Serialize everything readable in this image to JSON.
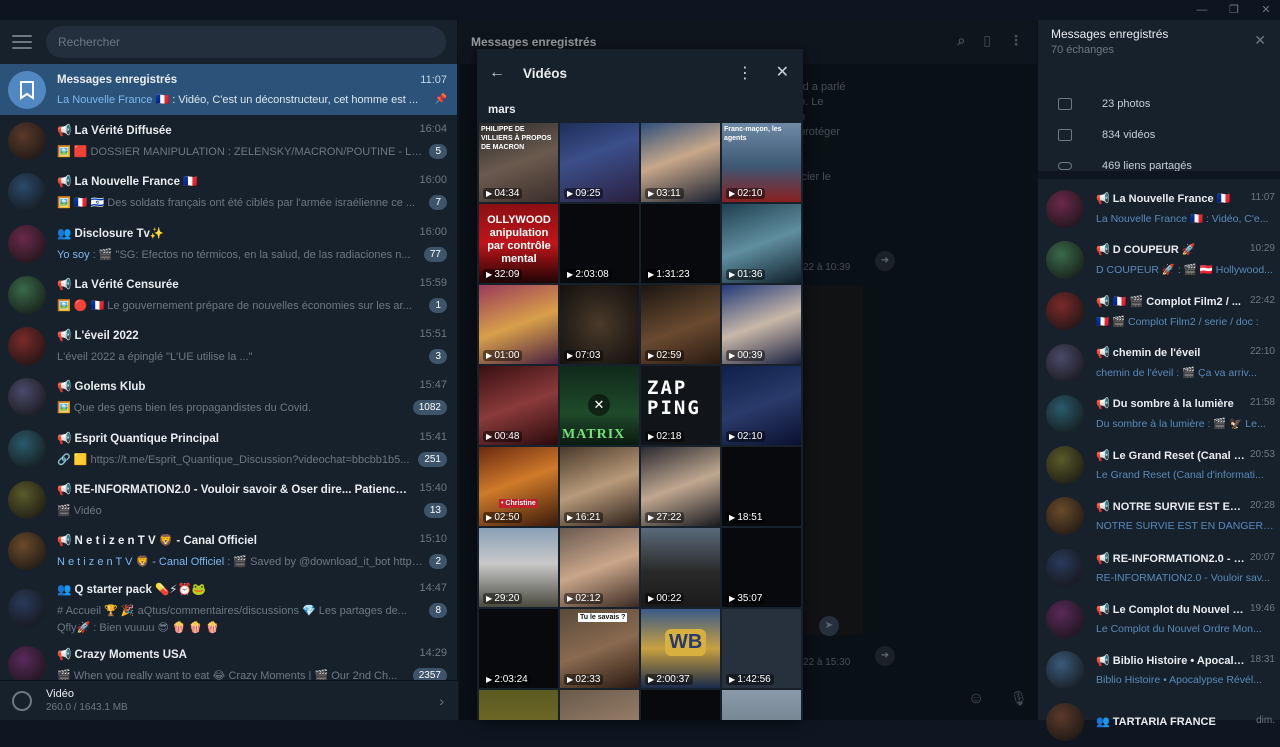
{
  "window": {
    "minimize_glyph": "—",
    "maximize_glyph": "❐",
    "close_glyph": "✕"
  },
  "left": {
    "search_placeholder": "Rechercher",
    "chats": [
      {
        "name": "Messages enregistrés",
        "time": "11:07",
        "sender": "La Nouvelle France 🇫🇷",
        "msg": " : Vidéo, C'est un déconstructeur, cet homme est ...",
        "pinned": "📌",
        "active": true,
        "avatar": "bookmark-icon"
      },
      {
        "name": "📢 La Vérité Diffusée",
        "time": "16:04",
        "msg": "🖼️ 🟥 DOSSIER MANIPULATION : ZELENSKY/MACRON/POUTINE - LES PE...",
        "badge": "5"
      },
      {
        "name": "📢 La Nouvelle France 🇫🇷",
        "time": "16:00",
        "msg": "🖼️ 🇫🇷 🇮🇱 Des soldats français ont été ciblés par l'armée israélienne ce ...",
        "badge": "7"
      },
      {
        "name": "👥 Disclosure Tv✨",
        "time": "16:00",
        "sender": "Yo soy",
        "msg": " : 🎬 \"SG: Efectos no térmicos, en la salud, de las radiaciones n...",
        "badge": "77"
      },
      {
        "name": "📢 La Vérité Censurée",
        "time": "15:59",
        "msg": "🖼️ 🔴 🇫🇷 Le gouvernement prépare de nouvelles économies sur les ar...",
        "badge": "1"
      },
      {
        "name": "📢 L'éveil 2022",
        "time": "15:51",
        "msg": "L'éveil 2022 a épinglé \"L'UE utilise la ...\"",
        "badge": "3"
      },
      {
        "name": "📢 Golems Klub",
        "time": "15:47",
        "msg": "🖼️ Que des gens bien les propagandistes du Covid.",
        "badge": "1082"
      },
      {
        "name": "📢 Esprit Quantique Principal",
        "time": "15:41",
        "msg": "🔗 🟨 https://t.me/Esprit_Quantique_Discussion?videochat=bbcbb1b5...",
        "badge": "251"
      },
      {
        "name": "📢 RE-INFORMATION2.0 - Vouloir savoir & Oser dire... Patience & Pers...",
        "time": "15:40",
        "msg": "🎬 Vidéo",
        "badge": "13"
      },
      {
        "name": "📢 N e t i z e n T V 🦁 - Canal Officiel",
        "time": "15:10",
        "sender": "N e t i z e n T V 🦁 - Canal Officiel",
        "msg": " : 🎬 Saved by @download_it_bot https...",
        "badge": "2"
      },
      {
        "name": "👥 Q starter pack 💊⚡⏰🐸",
        "time": "14:47",
        "msg": "# Accueil 🏆 🎉 aQtus/commentaires/discussions 💎 Les partages de...",
        "msg2": "Qfly🚀 : Bien vuuuu 😎 🍿 🍿 🍿",
        "badge": "8"
      },
      {
        "name": "📢 Crazy Moments USA",
        "time": "14:29",
        "msg": "🎬 When you really want to eat 😂 Crazy Moments | 🎬 Our 2nd Ch...",
        "badge": "2357"
      }
    ],
    "bottom": {
      "title": "Vidéo",
      "size": "260.0 / 1643.1 MB"
    }
  },
  "center": {
    "title": "Messages enregistrés",
    "bg_lines": [
      "rd a parlé",
      "b. Le",
      "n",
      "protéger",
      "",
      "",
      "icier le"
    ],
    "time1": "22 à 10:39",
    "time2": "22 à 15:30"
  },
  "panel": {
    "title": "Vidéos",
    "month": "mars",
    "tiles": [
      {
        "duration": "04:34",
        "bg": "linear-gradient(160deg,#2a2a2a 0%,#6b5a4e 50%,#3b2e2a 100%)",
        "text": "PHILIPPE DE VILLIERS À PROPOS DE MACRON"
      },
      {
        "duration": "09:25",
        "bg": "linear-gradient(160deg,#1d2f59 0%,#3b4f8a 40%,#2a2040 100%)"
      },
      {
        "duration": "03:11",
        "bg": "linear-gradient(160deg,#2f4f7a 0%,#c8a88a 45%,#1a2030 100%)"
      },
      {
        "duration": "02:10",
        "bg": "linear-gradient(180deg,#6f8aa6 0%,#3d5873 55%,#8a2020 100%)",
        "text": "Franc-maçon, les agents"
      },
      {
        "duration": "32:09",
        "bg": "linear-gradient(180deg,#8a0f12 0%,#c0151a 50%,#200405 100%)",
        "text": "OLLYWOOD anipulation par contrôle mental"
      },
      {
        "duration": "2:03:08",
        "bg": "#07090c"
      },
      {
        "duration": "1:31:23",
        "bg": "#07090c"
      },
      {
        "duration": "01:36",
        "bg": "linear-gradient(160deg,#1f3f4f 0%,#5f8fa0 50%,#0f1f2a 100%)"
      },
      {
        "duration": "01:00",
        "bg": "linear-gradient(160deg,#9a3a5a 0%,#d8a04a 50%,#4a2040 100%)"
      },
      {
        "duration": "07:03",
        "bg": "radial-gradient(circle,#4a3a2a 0%,#2a221a 55%,#141010 100%)"
      },
      {
        "duration": "02:59",
        "bg": "linear-gradient(160deg,#1a1612 0%,#6a4a30 55%,#2a1a10 100%)"
      },
      {
        "duration": "00:39",
        "bg": "linear-gradient(160deg,#223a7a 0%,#c8b8a8 50%,#1a2040 100%)"
      },
      {
        "duration": "00:48",
        "bg": "linear-gradient(160deg,#3a0f12 0%,#8a3a3a 50%,#2a0a0c 100%)"
      },
      {
        "duration": "",
        "bg": "linear-gradient(180deg,#0f2a1a 0%,#1f4a2a 60%,#0a1a10 100%)",
        "text": "MATRIX",
        "closeglyph": "✕"
      },
      {
        "duration": "02:18",
        "bg": "#111418",
        "text": "ZAP PING"
      },
      {
        "duration": "02:10",
        "bg": "linear-gradient(160deg,#10204a 0%,#2a3a6a 50%,#0a1030 100%)"
      },
      {
        "duration": "02:50",
        "bg": "linear-gradient(160deg,#6a2a10 0%,#d07a2a 45%,#3a1a0a 100%)",
        "text": "• Christine"
      },
      {
        "duration": "16:21",
        "bg": "linear-gradient(160deg,#4a3a2a 0%,#b89a7a 50%,#2a2018 100%)"
      },
      {
        "duration": "27:22",
        "bg": "linear-gradient(160deg,#2a2a30 0%,#c0a890 50%,#1a1a20 100%)"
      },
      {
        "duration": "18:51",
        "bg": "#07090c"
      },
      {
        "duration": "29:20",
        "bg": "linear-gradient(180deg,#8aa0b8 0%,#c8c8c8 45%,#4a4a40 100%)"
      },
      {
        "duration": "02:12",
        "bg": "linear-gradient(160deg,#6a5a50 0%,#caa68a 50%,#3a2a22 100%)"
      },
      {
        "duration": "00:22",
        "bg": "linear-gradient(180deg,#5a6a7a 0%,#2a2a2a 55%,#1a1a1a 100%)"
      },
      {
        "duration": "35:07",
        "bg": "#07090c"
      },
      {
        "duration": "2:03:24",
        "bg": "#07090c"
      },
      {
        "duration": "02:33",
        "bg": "linear-gradient(160deg,#5a4a3a 0%,#8a6a50 50%,#2a1a12 100%)",
        "text": "Tu le savais ?"
      },
      {
        "duration": "2:00:37",
        "bg": "linear-gradient(180deg,#3a5a8a 0%,#c8a040 50%,#1a2a4a 100%)",
        "text": "WB"
      },
      {
        "duration": "1:42:56",
        "bg": "#26313d"
      },
      {
        "duration": "",
        "bg": "linear-gradient(180deg,#5a5a20 0%,#8a7a30 100%)"
      },
      {
        "duration": "",
        "bg": "linear-gradient(160deg,#6a5a4a 0%,#b89a80 100%)"
      },
      {
        "duration": "",
        "bg": "#07090c"
      },
      {
        "duration": "",
        "bg": "linear-gradient(180deg,#8a9aaa 0%,#5a6a70 100%)"
      }
    ]
  },
  "right": {
    "title": "Messages enregistrés",
    "subtitle": "70 échanges",
    "stats": [
      {
        "icon": "photo-icon",
        "label": "23 photos"
      },
      {
        "icon": "video-icon",
        "label": "834 vidéos"
      },
      {
        "icon": "link-icon",
        "label": "469 liens partagés"
      }
    ],
    "chats": [
      {
        "name": "📢 La Nouvelle France 🇫🇷",
        "time": "11:07",
        "msg": "La Nouvelle France 🇫🇷 : Vidéo, C'e..."
      },
      {
        "name": "📢 D COUPEUR 🚀",
        "time": "10:29",
        "msg": "D COUPEUR 🚀 : 🎬 🇦🇹 Hollywood..."
      },
      {
        "name": "📢 🇫🇷 🎬 Complot Film2 / ...",
        "time": "22:42",
        "msg": "🇫🇷 🎬 Complot Film2 / serie / doc :"
      },
      {
        "name": "📢 chemin de l'éveil",
        "time": "22:10",
        "msg": "chemin de l'éveil : 🎬 Ça va arriv..."
      },
      {
        "name": "📢 Du sombre à la lumière",
        "time": "21:58",
        "msg": "Du sombre à la lumière : 🎬 🦅 Le..."
      },
      {
        "name": "📢 Le Grand Reset (Canal d'...",
        "time": "20:53",
        "msg": "Le Grand Reset (Canal d'informati..."
      },
      {
        "name": "📢 NOTRE SURVIE EST EN D...",
        "time": "20:28",
        "msg": "NOTRE SURVIE EST EN DANGER, N..."
      },
      {
        "name": "📢 RE-INFORMATION2.0 - V...",
        "time": "20:07",
        "msg": "RE-INFORMATION2.0 - Vouloir sav..."
      },
      {
        "name": "📢 Le Complot du Nouvel O...",
        "time": "19:46",
        "msg": "Le Complot du Nouvel Ordre Mon..."
      },
      {
        "name": "📢 Biblio Histoire • Apocalyp...",
        "time": "18:31",
        "msg": "Biblio Histoire • Apocalypse Révél..."
      },
      {
        "name": "👥 TARTARIA FRANCE",
        "time": "dim."
      }
    ]
  }
}
